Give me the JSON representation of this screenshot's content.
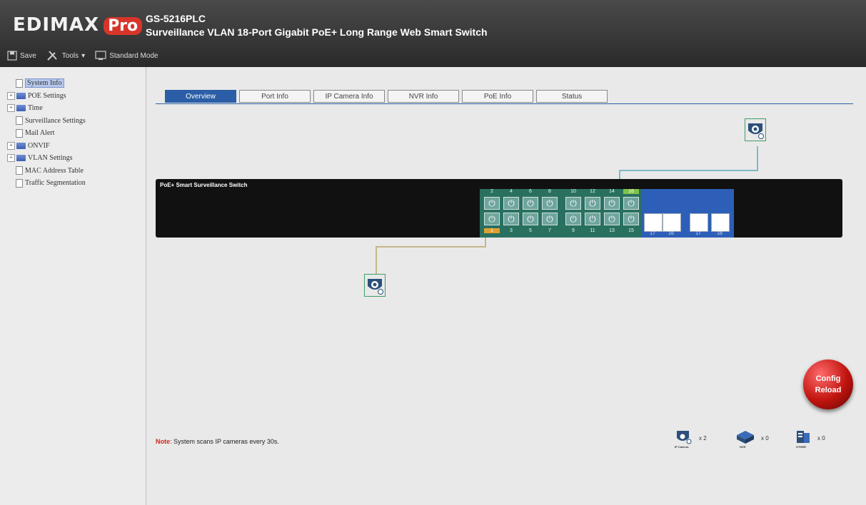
{
  "header": {
    "brand": "EDIMAX",
    "brand_badge": "Pro",
    "model": "GS-5216PLC",
    "subtitle": "Surveillance VLAN 18-Port Gigabit PoE+ Long Range Web Smart Switch",
    "toolbar": {
      "save": "Save",
      "tools": "Tools",
      "mode": "Standard Mode"
    }
  },
  "sidebar": {
    "items": [
      {
        "label": "System Info",
        "icon": "page-icon",
        "selected": true
      },
      {
        "label": "POE Settings",
        "icon": "folder-icon",
        "expandable": true
      },
      {
        "label": "Time",
        "icon": "folder-icon",
        "expandable": true
      },
      {
        "label": "Surveillance Settings",
        "icon": "page-icon"
      },
      {
        "label": "Mail Alert",
        "icon": "page-icon"
      },
      {
        "label": "ONVIF",
        "icon": "folder-icon",
        "expandable": true
      },
      {
        "label": "VLAN Settings",
        "icon": "folder-icon",
        "expandable": true
      },
      {
        "label": "MAC Address Table",
        "icon": "page-icon"
      },
      {
        "label": "Traffic Segmentation",
        "icon": "page-icon"
      }
    ]
  },
  "tabs": [
    {
      "label": "Overview",
      "active": true
    },
    {
      "label": "Port Info"
    },
    {
      "label": "IP Camera Info"
    },
    {
      "label": "NVR Info"
    },
    {
      "label": "PoE Info"
    },
    {
      "label": "Status"
    }
  ],
  "switch": {
    "label": "PoE+ Smart Surveillance Switch",
    "top_ports": [
      "2",
      "4",
      "6",
      "8",
      "10",
      "12",
      "14",
      "16"
    ],
    "bottom_ports": [
      "1",
      "3",
      "5",
      "7",
      "9",
      "11",
      "13",
      "15"
    ],
    "sfp_ports": [
      "17",
      "16",
      "17",
      "18"
    ],
    "active_top_port": "16",
    "active_bottom_port": "1"
  },
  "note": {
    "label": "Note",
    "text": ": System scans IP cameras every 30s."
  },
  "legend": {
    "ipcam_count": "x 2",
    "ipcam_caption": "IP Camera",
    "nvr_count": "x 0",
    "nvr_caption": "NVR",
    "other_count": "x 0",
    "other_caption": "OTHER"
  },
  "reload_button": {
    "line1": "Config",
    "line2": "Reload"
  },
  "colors": {
    "accent": "#2b5ea6",
    "port_green": "#2a7060",
    "sfp_blue": "#2d5fb8",
    "note_red": "#d4231b"
  }
}
